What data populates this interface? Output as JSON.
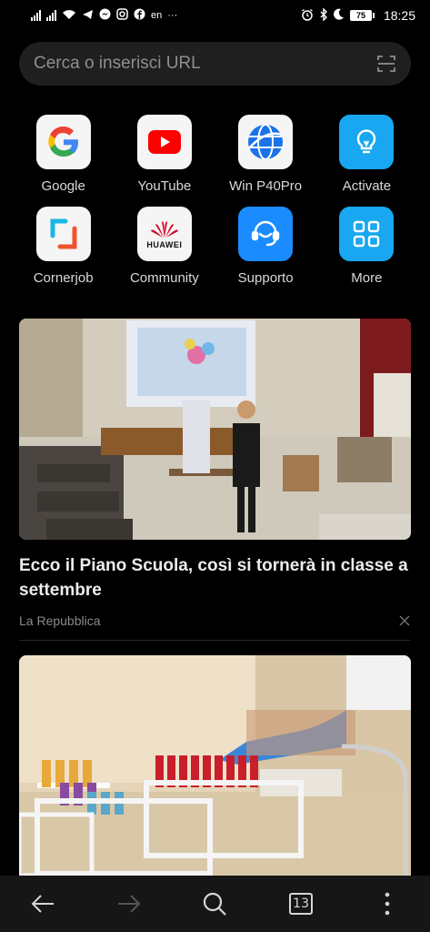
{
  "status_bar": {
    "lang": "en",
    "more": "···",
    "battery": "75",
    "time": "18:25"
  },
  "search": {
    "placeholder": "Cerca o inserisci URL"
  },
  "shortcuts": [
    {
      "label": "Google",
      "icon": "google-icon"
    },
    {
      "label": "YouTube",
      "icon": "youtube-icon"
    },
    {
      "label": "Win P40Pro",
      "icon": "globe-icon"
    },
    {
      "label": "Activate",
      "icon": "lightbulb-icon"
    },
    {
      "label": "Cornerjob",
      "icon": "cornerjob-icon"
    },
    {
      "label": "Community",
      "icon": "huawei-icon",
      "brand_text": "HUAWEI"
    },
    {
      "label": "Supporto",
      "icon": "support-agent-icon"
    },
    {
      "label": "More",
      "icon": "grid-icon"
    }
  ],
  "news": [
    {
      "headline": "Ecco il Piano Scuola, così si tornerà in classe a settembre",
      "source": "La Repubblica"
    },
    {
      "headline": "",
      "source": ""
    }
  ],
  "nav": {
    "tab_count": "13"
  },
  "colors": {
    "background": "#000000",
    "search_bg": "#1f1f1f",
    "youtube_red": "#ff0000",
    "huawei_red": "#cf0a2c",
    "blue_tile": "#1a8cff"
  }
}
